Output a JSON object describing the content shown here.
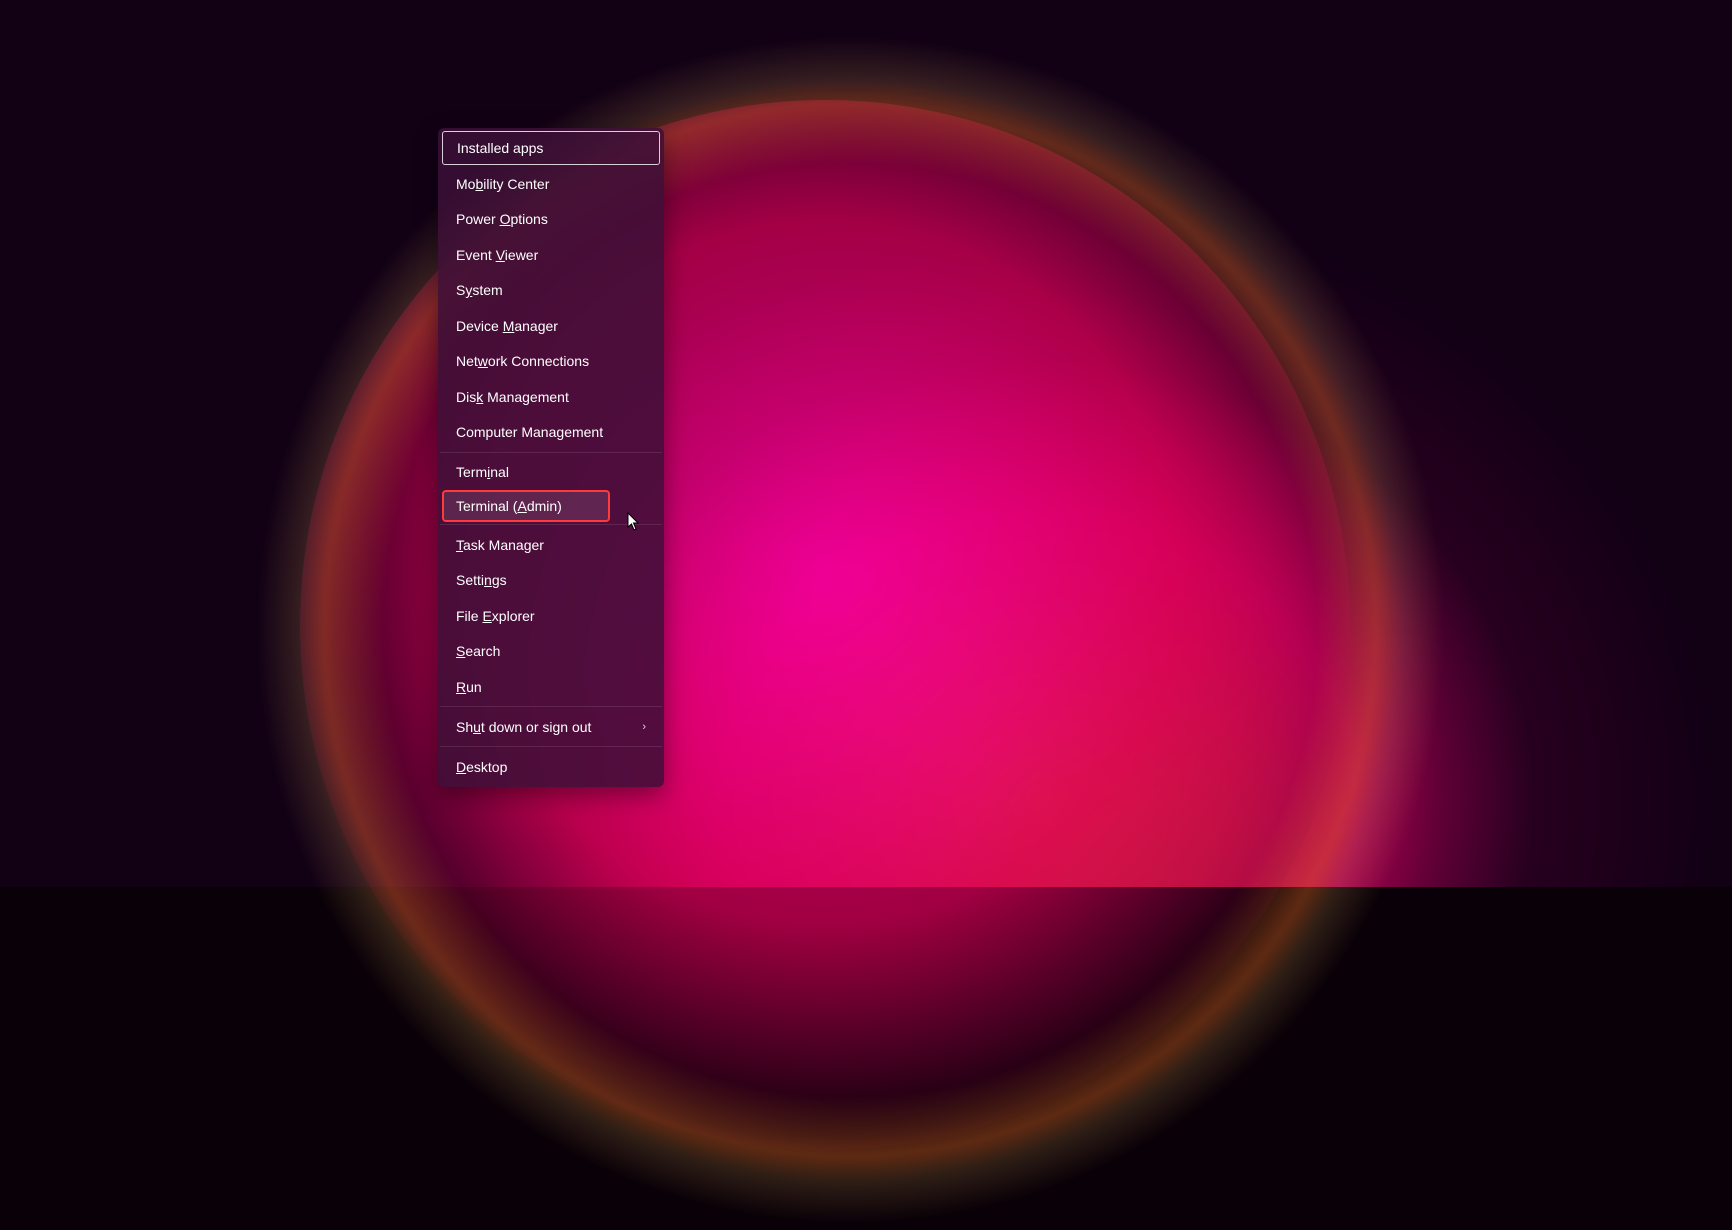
{
  "menu": {
    "items": [
      {
        "id": "installed-apps",
        "pre": "",
        "u": "",
        "post": "Installed apps",
        "focused": true
      },
      {
        "id": "mobility-center",
        "pre": "Mo",
        "u": "b",
        "post": "ility Center"
      },
      {
        "id": "power-options",
        "pre": "Power ",
        "u": "O",
        "post": "ptions"
      },
      {
        "id": "event-viewer",
        "pre": "Event ",
        "u": "V",
        "post": "iewer"
      },
      {
        "id": "system",
        "pre": "S",
        "u": "y",
        "post": "stem"
      },
      {
        "id": "device-manager",
        "pre": "Device ",
        "u": "M",
        "post": "anager"
      },
      {
        "id": "network-connections",
        "pre": "Net",
        "u": "w",
        "post": "ork Connections"
      },
      {
        "id": "disk-management",
        "pre": "Dis",
        "u": "k",
        "post": " Management"
      },
      {
        "id": "computer-management",
        "pre": "Computer Mana",
        "u": "g",
        "post": "ement"
      },
      {
        "id": "terminal",
        "pre": "Term",
        "u": "i",
        "post": "nal",
        "separator_before": true
      },
      {
        "id": "terminal-admin",
        "pre": "Terminal (",
        "u": "A",
        "post": "dmin)",
        "hover": true,
        "highlight": true
      },
      {
        "id": "task-manager",
        "pre": "",
        "u": "T",
        "post": "ask Manager",
        "separator_before": true
      },
      {
        "id": "settings",
        "pre": "Setti",
        "u": "n",
        "post": "gs"
      },
      {
        "id": "file-explorer",
        "pre": "File ",
        "u": "E",
        "post": "xplorer"
      },
      {
        "id": "search",
        "pre": "",
        "u": "S",
        "post": "earch"
      },
      {
        "id": "run",
        "pre": "",
        "u": "R",
        "post": "un"
      },
      {
        "id": "shutdown-signout",
        "pre": "Sh",
        "u": "u",
        "post": "t down or sign out",
        "submenu": true,
        "separator_before": true
      },
      {
        "id": "desktop",
        "pre": "",
        "u": "D",
        "post": "esktop",
        "separator_before": true
      }
    ]
  },
  "highlight_color": "#ff3a3a"
}
